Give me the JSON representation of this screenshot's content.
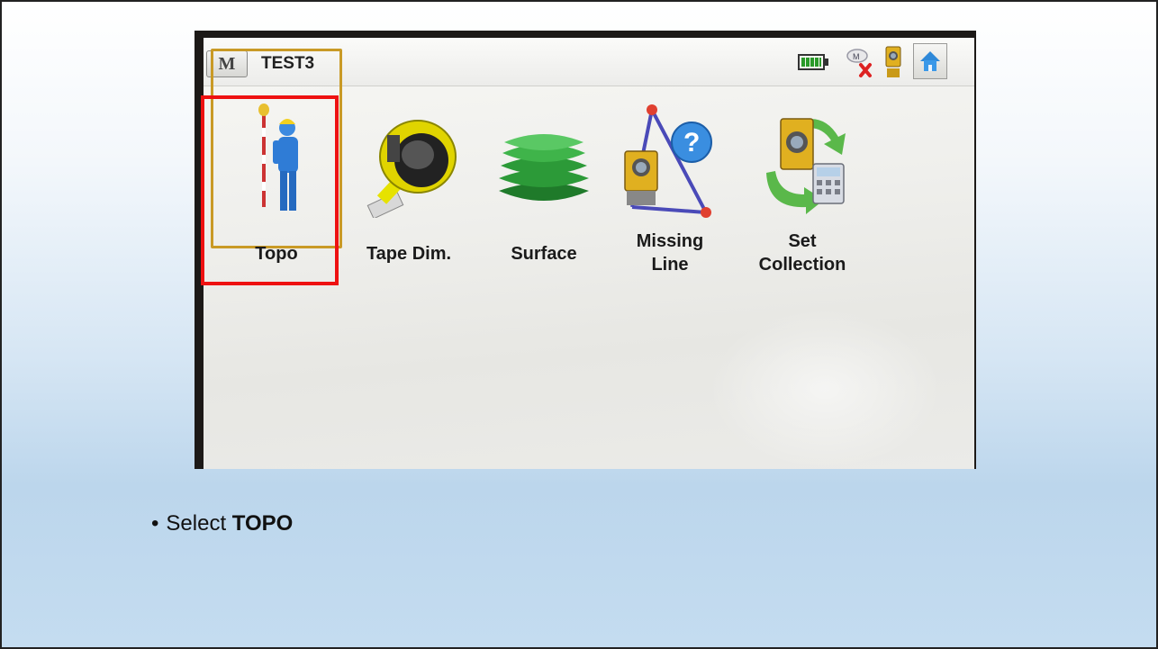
{
  "device": {
    "menu_button_label": "M",
    "job_name": "TEST3",
    "status_icons": [
      "battery-icon",
      "radio-disconnected-icon",
      "total-station-icon",
      "home-icon"
    ]
  },
  "apps": [
    {
      "id": "topo",
      "label": "Topo",
      "icon": "surveyor-icon",
      "selected": true
    },
    {
      "id": "tape-dim",
      "label": "Tape Dim.",
      "icon": "tape-measure-icon"
    },
    {
      "id": "surface",
      "label": "Surface",
      "icon": "surface-layers-icon"
    },
    {
      "id": "missing-line",
      "label_line1": "Missing",
      "label_line2": "Line",
      "icon": "missing-line-icon"
    },
    {
      "id": "set-collection",
      "label_line1": "Set",
      "label_line2": "Collection",
      "icon": "set-collection-icon"
    }
  ],
  "highlight_color": "#ee1111",
  "instruction": {
    "bullet": "•",
    "prefix": "Select ",
    "emphasis": "TOPO"
  }
}
